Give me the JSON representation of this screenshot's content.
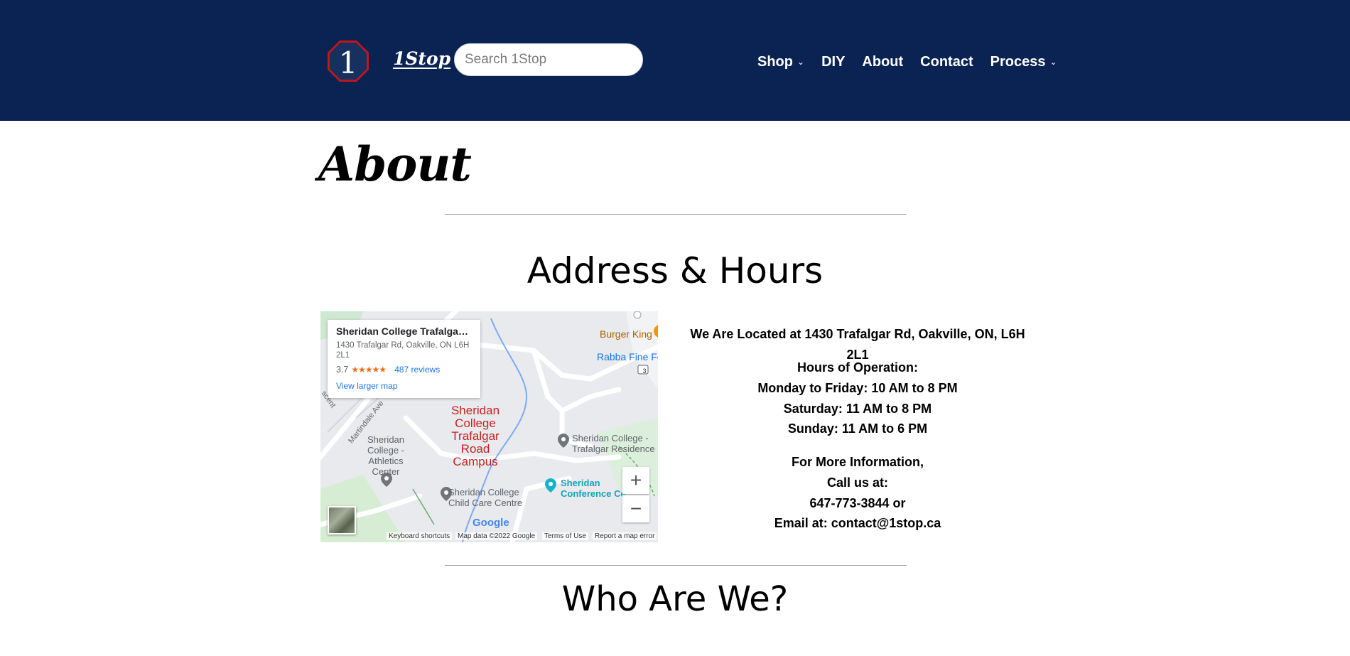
{
  "header": {
    "logo_numeral": "1",
    "brand": "1Stop",
    "search_placeholder": "Search 1Stop",
    "nav": [
      {
        "label": "Shop",
        "has_dropdown": true
      },
      {
        "label": "DIY",
        "has_dropdown": false
      },
      {
        "label": "About",
        "has_dropdown": false
      },
      {
        "label": "Contact",
        "has_dropdown": false
      },
      {
        "label": "Process",
        "has_dropdown": true
      }
    ]
  },
  "page": {
    "title": "About",
    "address_heading": "Address & Hours",
    "who_heading": "Who Are We?"
  },
  "map": {
    "card_title": "Sheridan College Trafalgar Ro...",
    "card_address": "1430 Trafalgar Rd, Oakville, ON L6H 2L1",
    "rating": "3.7",
    "stars": "★★★★★",
    "reviews": "487 reviews",
    "view_larger": "View larger map",
    "labels": {
      "campus": "Sheridan College Trafalgar Road Campus",
      "burger_king": "Burger King",
      "rabba": "Rabba Fine Fo",
      "residence": "Sheridan College - Trafalgar Residence",
      "athletics": "Sheridan College - Athletics Center",
      "child_care": "Sheridan College Child Care Centre",
      "conference": "Sheridan Conference Ce",
      "martindale": "Martindale Ave",
      "crescent": "scent",
      "route_badge": "3"
    },
    "zoom_in": "+",
    "zoom_out": "−",
    "google": "Google",
    "footer": {
      "shortcuts": "Keyboard shortcuts",
      "data": "Map data ©2022 Google",
      "terms": "Terms of Use",
      "report": "Report a map error"
    }
  },
  "info": {
    "location": "We Are Located at 1430 Trafalgar Rd, Oakville, ON, L6H 2L1",
    "hours_title": "Hours of Operation:",
    "hours": [
      "Monday to Friday: 10 AM to 8 PM",
      "Saturday: 11 AM to 8 PM",
      "Sunday: 11 AM to 6 PM"
    ],
    "contact_title": "For More Information,",
    "call": "Call us at:",
    "phone": "647-773-3844 or",
    "email": "Email at: contact@1stop.ca"
  },
  "colors": {
    "header_bg": "#0b2353",
    "logo_red": "#c0171d",
    "link_blue": "#1a73e8"
  }
}
